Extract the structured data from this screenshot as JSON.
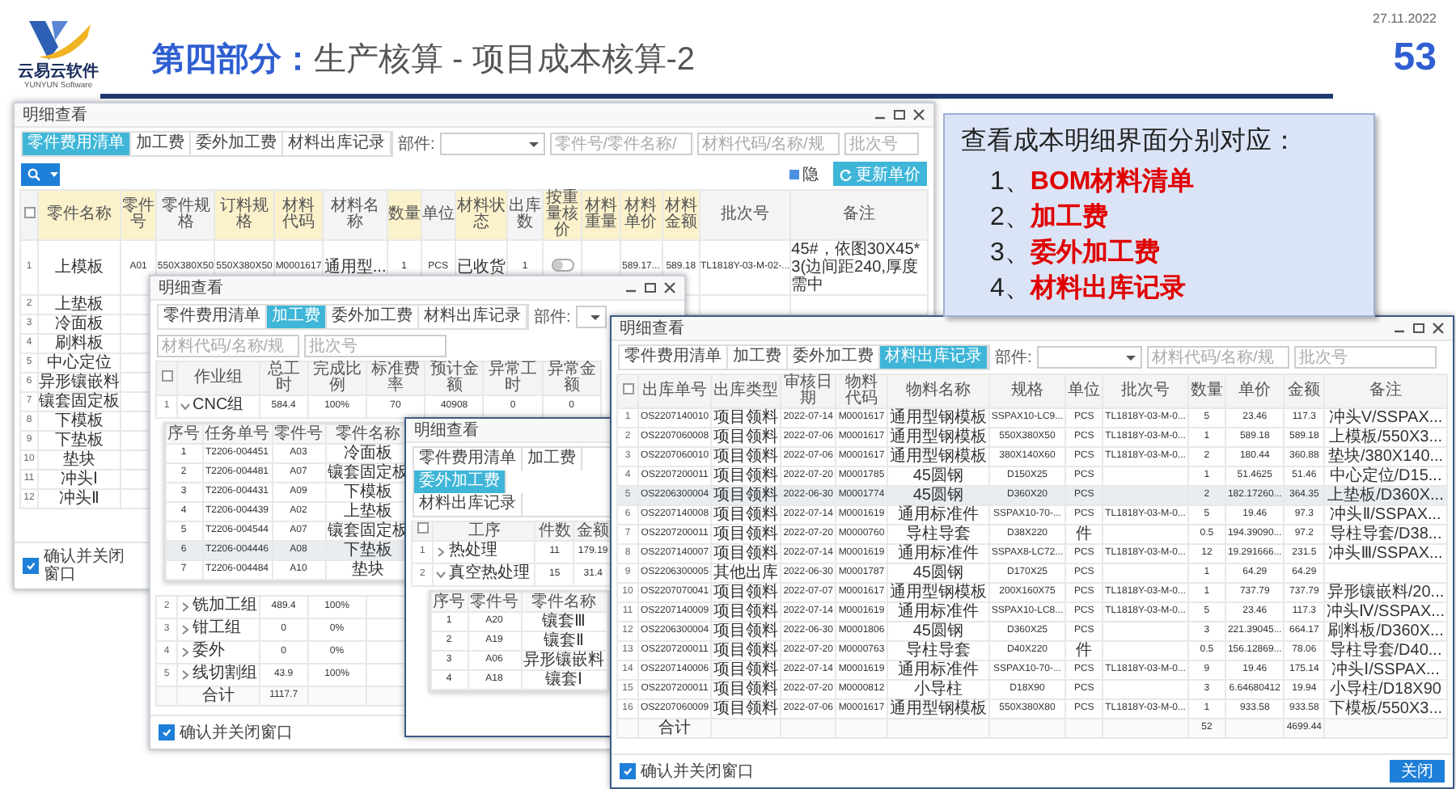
{
  "header": {
    "logo_text": "云易云软件",
    "logo_subtext": "YUNYUN Software",
    "title_prefix": "第四部分：",
    "title": "生产核算 - 项目成本核算-2",
    "date": "27.11.2022",
    "page_number": "53"
  },
  "callout": {
    "heading": "查看成本明细界面分别对应：",
    "items": [
      {
        "number": "1、",
        "text": "BOM材料清单"
      },
      {
        "number": "2、",
        "text": "加工费"
      },
      {
        "number": "3、",
        "text": "委外加工费"
      },
      {
        "number": "4、",
        "text": "材料出库记录"
      }
    ]
  },
  "windows": [
    {
      "title": "明细查看",
      "window_controls": true,
      "tabs": [
        {
          "label": "零件费用清单",
          "selected": true
        },
        {
          "label": "加工费",
          "selected": false
        },
        {
          "label": "委外加工费",
          "selected": false
        },
        {
          "label": "材料出库记录",
          "selected": false
        }
      ],
      "part_label": "部件:",
      "filters": [
        {
          "placeholder": "零件号/零件名称/"
        },
        {
          "placeholder": "材料代码/名称/规"
        },
        {
          "placeholder": "批次号"
        }
      ],
      "actions": [
        {
          "kind": "search"
        },
        {
          "kind": "menu"
        },
        {
          "kind": "legend",
          "label": "隐"
        },
        {
          "kind": "button",
          "label": "更新单价"
        }
      ],
      "table": {
        "all_selected": false,
        "columns": [
          {
            "label": "零件名称",
            "highlighted": true
          },
          {
            "label": "零件号",
            "highlighted": true
          },
          {
            "label": "零件规格",
            "highlighted": false
          },
          {
            "label": "订料规格",
            "highlighted": true
          },
          {
            "label": "材料代码",
            "highlighted": true
          },
          {
            "label": "材料名称",
            "highlighted": false
          },
          {
            "label": "数量",
            "highlighted": true
          },
          {
            "label": "单位",
            "highlighted": false
          },
          {
            "label": "材料状态",
            "highlighted": true
          },
          {
            "label": "出库数",
            "highlighted": false
          },
          {
            "label": "按重量核价",
            "highlighted": true
          },
          {
            "label": "材料重量",
            "highlighted": true
          },
          {
            "label": "材料单价",
            "highlighted": true
          },
          {
            "label": "材料金额",
            "highlighted": true
          },
          {
            "label": "批次号",
            "highlighted": false
          },
          {
            "label": "备注",
            "highlighted": false
          }
        ],
        "rows": [
          {
            "no": "1",
            "cells": [
              "上模板",
              "A01",
              "550X380X50",
              "550X380X50",
              "M0001617",
              "通用型...",
              "1",
              "PCS",
              "已收货",
              "1",
              {
                "kind": "switch",
                "on": false
              },
              null,
              "589.17...",
              "589.18",
              "TL1818Y-03-M-02-...",
              "45#，依图30X45*3(边间距240,厚度需中"
            ]
          },
          {
            "no": "2",
            "cells": [
              "上垫板"
            ]
          },
          {
            "no": "3",
            "cells": [
              "冷面板"
            ]
          },
          {
            "no": "4",
            "cells": [
              "刷料板"
            ]
          },
          {
            "no": "5",
            "cells": [
              "中心定位"
            ]
          },
          {
            "no": "6",
            "cells": [
              "异形镶嵌料"
            ]
          },
          {
            "no": "7",
            "cells": [
              "镶套固定板"
            ]
          },
          {
            "no": "8",
            "cells": [
              "下模板"
            ]
          },
          {
            "no": "9",
            "cells": [
              "下垫板"
            ]
          },
          {
            "no": "10",
            "cells": [
              "垫块"
            ]
          },
          {
            "no": "11",
            "cells": [
              "冲头Ⅰ"
            ]
          },
          {
            "no": "12",
            "cells": [
              "冲头Ⅱ"
            ]
          }
        ]
      },
      "confirm": {
        "label": "确认并关闭窗口",
        "checked": true
      }
    },
    {
      "title": "明细查看",
      "window_controls": true,
      "tabs": [
        {
          "label": "零件费用清单",
          "selected": false
        },
        {
          "label": "加工费",
          "selected": true
        },
        {
          "label": "委外加工费",
          "selected": false
        },
        {
          "label": "材料出库记录",
          "selected": false
        }
      ],
      "part_label": "部件:",
      "filters": [
        {
          "placeholder": "材料代码/名称/规"
        },
        {
          "placeholder": "批次号"
        }
      ],
      "table": {
        "all_selected": false,
        "columns": [
          {
            "label": "作业组",
            "total": "合计"
          },
          {
            "label": "总工时",
            "total": "1117.7"
          },
          {
            "label": "完成比例"
          },
          {
            "label": "标准费率"
          },
          {
            "label": "预计金额"
          },
          {
            "label": "异常工时"
          },
          {
            "label": "异常金额"
          }
        ],
        "rows": [
          {
            "no": "1",
            "cells": [
              "CNC组",
              "584.4",
              "100%",
              "70",
              "40908",
              "0",
              "0"
            ],
            "expanded": true,
            "detail": {
              "columns": [
                {
                  "label": "序号"
                },
                {
                  "label": "任务单号"
                },
                {
                  "label": "零件号"
                },
                {
                  "label": "零件名称"
                }
              ],
              "rows": [
                {
                  "cells": [
                    "1",
                    "T2206-004451",
                    "A03",
                    "冷面板"
                  ],
                  "selected": false
                },
                {
                  "cells": [
                    "2",
                    "T2206-004481",
                    "A07",
                    "镶套固定板"
                  ],
                  "selected": false
                },
                {
                  "cells": [
                    "3",
                    "T2206-004431",
                    "A09",
                    "下模板"
                  ],
                  "selected": false
                },
                {
                  "cells": [
                    "4",
                    "T2206-004439",
                    "A02",
                    "上垫板"
                  ],
                  "selected": false
                },
                {
                  "cells": [
                    "5",
                    "T2206-004544",
                    "A07",
                    "镶套固定板"
                  ],
                  "selected": false
                },
                {
                  "cells": [
                    "6",
                    "T2206-004446",
                    "A08",
                    "下垫板"
                  ],
                  "selected": true
                },
                {
                  "cells": [
                    "7",
                    "T2206-004484",
                    "A10",
                    "垫块"
                  ],
                  "selected": false
                }
              ]
            }
          },
          {
            "no": "2",
            "cells": [
              "铣加工组",
              "489.4",
              "100%"
            ],
            "expanded": false
          },
          {
            "no": "3",
            "cells": [
              "钳工组",
              "0",
              "0%"
            ],
            "expanded": false
          },
          {
            "no": "4",
            "cells": [
              "委外",
              "0",
              "0%"
            ],
            "expanded": false
          },
          {
            "no": "5",
            "cells": [
              "线切割组",
              "43.9",
              "100%"
            ],
            "expanded": false
          }
        ]
      },
      "confirm": {
        "label": "确认并关闭窗口",
        "checked": true
      }
    },
    {
      "title": "明细查看",
      "tabs": [
        {
          "label": "零件费用清单",
          "selected": false
        },
        {
          "label": "加工费",
          "selected": false
        },
        {
          "label": "委外加工费",
          "selected": true
        },
        {
          "label": "材料出库记录",
          "selected": false
        }
      ],
      "table": {
        "all_selected": false,
        "columns": [
          {
            "label": "工序"
          },
          {
            "label": "件数"
          },
          {
            "label": "金额"
          }
        ],
        "rows": [
          {
            "no": "1",
            "cells": [
              "热处理",
              "11",
              "179.19"
            ],
            "expanded": false
          },
          {
            "no": "2",
            "cells": [
              "真空热处理",
              "15",
              "31.4"
            ],
            "expanded": true,
            "detail": {
              "columns": [
                {
                  "label": "序号"
                },
                {
                  "label": "零件号"
                },
                {
                  "label": "零件名称"
                }
              ],
              "rows": [
                {
                  "cells": [
                    "1",
                    "A20",
                    "镶套Ⅲ"
                  ],
                  "selected": false
                },
                {
                  "cells": [
                    "2",
                    "A19",
                    "镶套Ⅱ"
                  ],
                  "selected": false
                },
                {
                  "cells": [
                    "3",
                    "A06",
                    "异形镶嵌料"
                  ],
                  "selected": false
                },
                {
                  "cells": [
                    "4",
                    "A18",
                    "镶套Ⅰ"
                  ],
                  "selected": false
                }
              ]
            }
          }
        ]
      }
    },
    {
      "title": "明细查看",
      "window_controls": true,
      "tabs": [
        {
          "label": "零件费用清单",
          "selected": false
        },
        {
          "label": "加工费",
          "selected": false
        },
        {
          "label": "委外加工费",
          "selected": false
        },
        {
          "label": "材料出库记录",
          "selected": true
        }
      ],
      "part_label": "部件:",
      "filters": [
        {
          "placeholder": "材料代码/名称/规"
        },
        {
          "placeholder": "批次号"
        }
      ],
      "table": {
        "all_selected": false,
        "columns": [
          {
            "label": "出库单号",
            "total": "合计"
          },
          {
            "label": "出库类型"
          },
          {
            "label": "审核日期"
          },
          {
            "label": "物料代码"
          },
          {
            "label": "物料名称"
          },
          {
            "label": "规格"
          },
          {
            "label": "单位"
          },
          {
            "label": "批次号"
          },
          {
            "label": "数量",
            "total": "52"
          },
          {
            "label": "单价"
          },
          {
            "label": "金额",
            "total": "4699.44"
          },
          {
            "label": "备注"
          }
        ],
        "rows": [
          {
            "no": "1",
            "cells": [
              "OS2207140010",
              "项目领料",
              "2022-07-14",
              "M0001617",
              "通用型钢模板",
              "SSPAX10-LC9...",
              "PCS",
              "TL1818Y-03-M-0...",
              "5",
              "23.46",
              "117.3",
              "冲头V/SSPAX..."
            ],
            "selected": false
          },
          {
            "no": "2",
            "cells": [
              "OS2207060008",
              "项目领料",
              "2022-07-06",
              "M0001617",
              "通用型钢模板",
              "550X380X50",
              "PCS",
              "TL1818Y-03-M-0...",
              "1",
              "589.18",
              "589.18",
              "上模板/550X3..."
            ],
            "selected": false
          },
          {
            "no": "3",
            "cells": [
              "OS2207060010",
              "项目领料",
              "2022-07-06",
              "M0001617",
              "通用型钢模板",
              "380X140X60",
              "PCS",
              "TL1818Y-03-M-0...",
              "2",
              "180.44",
              "360.88",
              "垫块/380X140..."
            ],
            "selected": false
          },
          {
            "no": "4",
            "cells": [
              "OS2207200011",
              "项目领料",
              "2022-07-20",
              "M0001785",
              "45圆钢",
              "D150X25",
              "PCS",
              null,
              "1",
              "51.4625",
              "51.46",
              "中心定位/D15..."
            ],
            "selected": false
          },
          {
            "no": "5",
            "cells": [
              "OS2206300004",
              "项目领料",
              "2022-06-30",
              "M0001774",
              "45圆钢",
              "D360X20",
              "PCS",
              null,
              "2",
              "182.17260...",
              "364.35",
              "上垫板/D360X..."
            ],
            "selected": true
          },
          {
            "no": "6",
            "cells": [
              "OS2207140008",
              "项目领料",
              "2022-07-14",
              "M0001619",
              "通用标准件",
              "SSPAX10-70-...",
              "PCS",
              "TL1818Y-03-M-0...",
              "5",
              "19.46",
              "97.3",
              "冲头Ⅱ/SSPAX..."
            ],
            "selected": false
          },
          {
            "no": "7",
            "cells": [
              "OS2207200011",
              "项目领料",
              "2022-07-20",
              "M0000760",
              "导柱导套",
              "D38X220",
              "件",
              null,
              "0.5",
              "194.39090...",
              "97.2",
              "导柱导套/D38..."
            ],
            "selected": false
          },
          {
            "no": "8",
            "cells": [
              "OS2207140007",
              "项目领料",
              "2022-07-14",
              "M0001619",
              "通用标准件",
              "SSPAX8-LC72...",
              "PCS",
              "TL1818Y-03-M-0...",
              "12",
              "19.291666...",
              "231.5",
              "冲头Ⅲ/SSPAX..."
            ],
            "selected": false
          },
          {
            "no": "9",
            "cells": [
              "OS2206300005",
              "其他出库",
              "2022-06-30",
              "M0001787",
              "45圆钢",
              "D170X25",
              "PCS",
              null,
              "1",
              "64.29",
              "64.29"
            ],
            "selected": false
          },
          {
            "no": "10",
            "cells": [
              "OS2207070041",
              "项目领料",
              "2022-07-07",
              "M0001617",
              "通用型钢模板",
              "200X160X75",
              "PCS",
              "TL1818Y-03-M-0...",
              "1",
              "737.79",
              "737.79",
              "异形镶嵌料/20..."
            ],
            "selected": false
          },
          {
            "no": "11",
            "cells": [
              "OS2207140009",
              "项目领料",
              "2022-07-14",
              "M0001619",
              "通用标准件",
              "SSPAX10-LC8...",
              "PCS",
              "TL1818Y-03-M-0...",
              "5",
              "23.46",
              "117.3",
              "冲头Ⅳ/SSPAX..."
            ],
            "selected": false
          },
          {
            "no": "12",
            "cells": [
              "OS2206300004",
              "项目领料",
              "2022-06-30",
              "M0001806",
              "45圆钢",
              "D360X25",
              "PCS",
              null,
              "3",
              "221.39045...",
              "664.17",
              "刷料板/D360X..."
            ],
            "selected": false
          },
          {
            "no": "13",
            "cells": [
              "OS2207200011",
              "项目领料",
              "2022-07-20",
              "M0000763",
              "导柱导套",
              "D40X220",
              "件",
              null,
              "0.5",
              "156.12869...",
              "78.06",
              "导柱导套/D40..."
            ],
            "selected": false
          },
          {
            "no": "14",
            "cells": [
              "OS2207140006",
              "项目领料",
              "2022-07-14",
              "M0001619",
              "通用标准件",
              "SSPAX10-70-...",
              "PCS",
              "TL1818Y-03-M-0...",
              "9",
              "19.46",
              "175.14",
              "冲头Ⅰ/SSPAX..."
            ],
            "selected": false
          },
          {
            "no": "15",
            "cells": [
              "OS2207200011",
              "项目领料",
              "2022-07-20",
              "M0000812",
              "小导柱",
              "D18X90",
              "PCS",
              null,
              "3",
              "6.64680412",
              "19.94",
              "小导柱/D18X90"
            ],
            "selected": false
          },
          {
            "no": "16",
            "cells": [
              "OS2207060009",
              "项目领料",
              "2022-07-06",
              "M0001617",
              "通用型钢模板",
              "550X380X80",
              "PCS",
              "TL1818Y-03-M-0...",
              "1",
              "933.58",
              "933.58",
              "下模板/550X3..."
            ],
            "selected": false
          }
        ]
      },
      "confirm": {
        "label": "确认并关闭窗口",
        "checked": true
      },
      "close_button": "关闭"
    }
  ]
}
